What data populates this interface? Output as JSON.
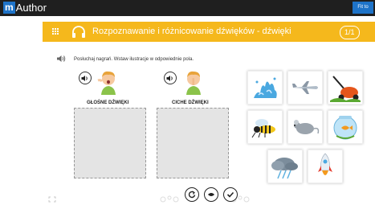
{
  "app": {
    "logo_m": "m",
    "logo_text": "Author",
    "top_button": "Fit to window"
  },
  "header": {
    "title": "Rozpoznawanie i różnicowanie dźwięków - dźwięki",
    "counter": "1/1"
  },
  "instruction": "Posłuchaj nagrań. Wstaw ilustracje w odpowiednie pola.",
  "columns": [
    {
      "label": "GŁOŚNE DŹWIĘKI"
    },
    {
      "label": "CICHE DŹWIĘKI"
    }
  ],
  "tiles": [
    {
      "name": "water-splash"
    },
    {
      "name": "airplane"
    },
    {
      "name": "lawn-mower"
    },
    {
      "name": "wasp"
    },
    {
      "name": "mouse"
    },
    {
      "name": "fish-bowl"
    },
    {
      "name": "storm-cloud"
    },
    {
      "name": "rocket"
    }
  ],
  "controls": [
    "reset-icon",
    "show-answers-icon",
    "check-icon"
  ],
  "colors": {
    "header": "#f5b81c",
    "topbar": "#1f1f1f",
    "accent": "#1e73c8"
  }
}
